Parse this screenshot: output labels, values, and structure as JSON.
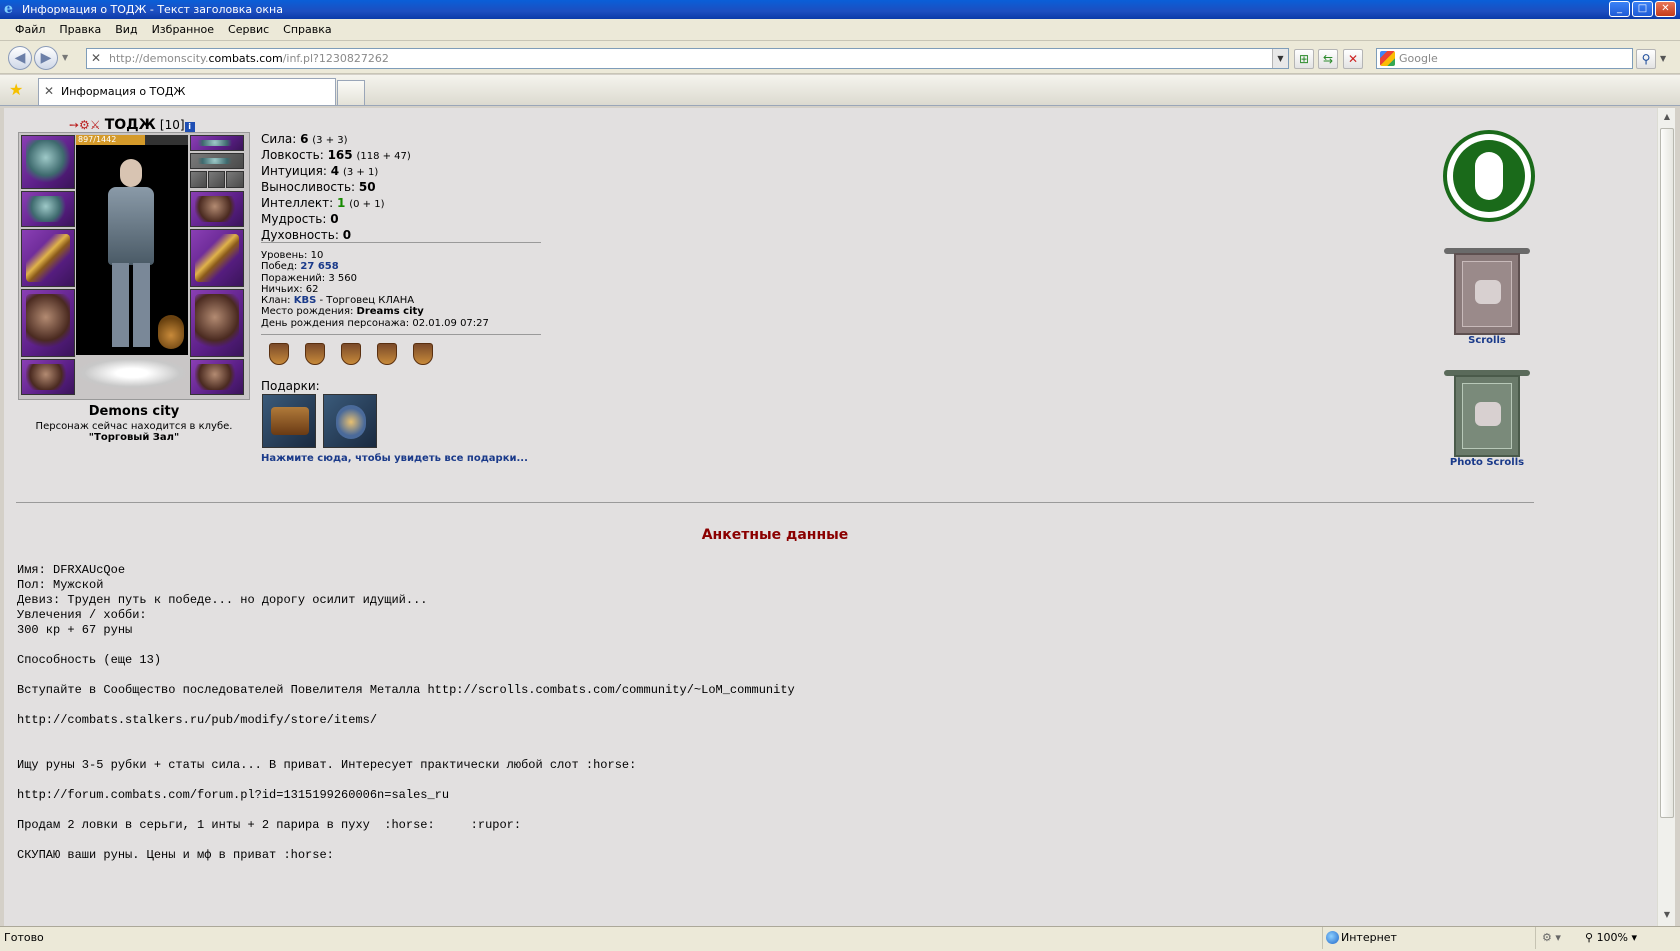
{
  "window": {
    "title": "Информация о ТОДЖ - Текст заголовка окна",
    "buttons": [
      "_",
      "□",
      "✕"
    ]
  },
  "menu": [
    "Файл",
    "Правка",
    "Вид",
    "Избранное",
    "Сервис",
    "Справка"
  ],
  "address": {
    "url_prefix": "http://demonscity.",
    "url_domain": "combats.com",
    "url_path": "/inf.pl?1230827262",
    "search_placeholder": "Google"
  },
  "tab": {
    "label": "Информация о ТОДЖ"
  },
  "status": {
    "left": "Готово",
    "zone": "Интернет",
    "zoom": "100%"
  },
  "character": {
    "name": "ТОДЖ",
    "level": "[10]",
    "info_label": "i",
    "hp": "897/1442",
    "hp_fraction": 0.62,
    "city": "Demons city",
    "location_text": "Персонаж сейчас находится в клубе.",
    "room": "\"Торговый Зал\""
  },
  "stats": [
    {
      "label": "Сила:",
      "value": "6",
      "detail": "(3 + 3)"
    },
    {
      "label": "Ловкость:",
      "value": "165",
      "detail": "(118 + 47)"
    },
    {
      "label": "Интуиция:",
      "value": "4",
      "detail": "(3 + 1)"
    },
    {
      "label": "Выносливость:",
      "value": "50",
      "detail": ""
    },
    {
      "label": "Интеллект:",
      "value": "1",
      "detail": "(0 + 1)"
    },
    {
      "label": "Мудрость:",
      "value": "0",
      "detail": ""
    },
    {
      "label": "Духовность:",
      "value": "0",
      "detail": ""
    }
  ],
  "info": {
    "level": "Уровень: 10",
    "wins_label": "Побед: ",
    "wins_value": "27 658",
    "losses": "Поражений: 3 560",
    "draws": "Ничьих: 62",
    "clan_label": "Клан: ",
    "clan_value": "KBS",
    "clan_role": " - Торговец КЛАНА",
    "birthplace_label": "Место рождения: ",
    "birthplace_value": "Dreams city",
    "birthday": "День рождения персонажа: 02.01.09 07:27"
  },
  "gifts": {
    "label": "Подарки:",
    "link": "Нажмите сюда, чтобы увидеть все подарки..."
  },
  "right_panel": {
    "scrolls_label": "Scrolls",
    "photo_scrolls_label": "Photo Scrolls"
  },
  "anketa": {
    "title": "Анкетные данные",
    "lines": [
      "Имя: DFRXAUcQoe",
      "Пол: Мужской",
      "Девиз: Труден путь к победе... но дорогу осилит идущий...",
      "Увлечения / хобби:",
      "300 кр + 67 руны",
      "",
      "Способность (еще 13)",
      "",
      "Вступайте в Сообщество последователей Повелителя Металла http://scrolls.combats.com/community/~LoM_community",
      "",
      "http://combats.stalkers.ru/pub/modify/store/items/",
      "",
      "",
      "Ищу руны 3-5 рубки + статы сила... В приват. Интересует практически любой слот :horse:",
      "",
      "http://forum.combats.com/forum.pl?id=1315199260006n=sales_ru",
      "",
      "Продам 2 ловки в серьги, 1 инты + 2 парира в пуху  :horse:     :rupor:",
      "",
      "СКУПАЮ ваши руны. Цены и мф в приват :horse:"
    ]
  }
}
